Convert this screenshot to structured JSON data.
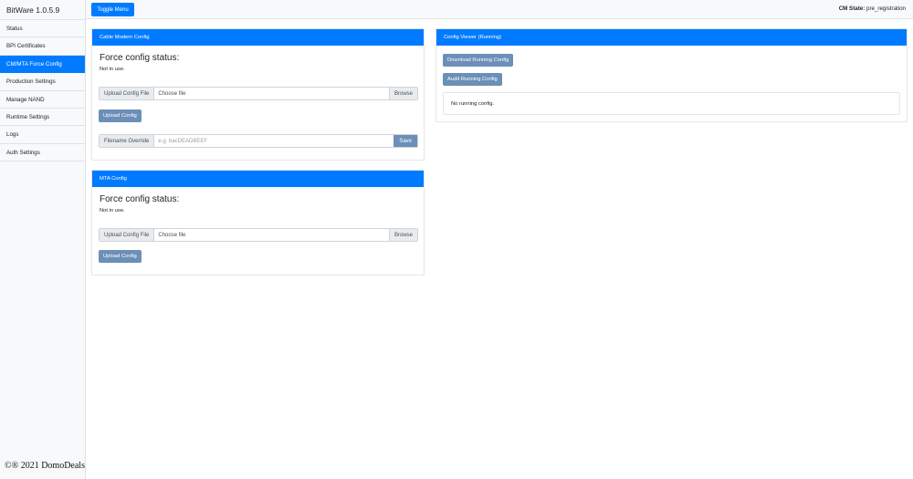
{
  "sidebar": {
    "brand": "BitWare 1.0.5.9",
    "items": [
      {
        "label": "Status",
        "active": false
      },
      {
        "label": "BPI Certificates",
        "active": false
      },
      {
        "label": "CM/MTA Force Config",
        "active": true
      },
      {
        "label": "Production Settings",
        "active": false
      },
      {
        "label": "Manage NAND",
        "active": false
      },
      {
        "label": "Runtime Settings",
        "active": false
      },
      {
        "label": "Logs",
        "active": false
      },
      {
        "label": "Auth Settings",
        "active": false
      }
    ]
  },
  "topbar": {
    "toggle_label": "Toggle Menu",
    "state_label": "CM State:",
    "state_value": "pre_registration"
  },
  "cm_card": {
    "title": "Cable Modem Config",
    "status_heading": "Force config status:",
    "status_text": "Not in use.",
    "upload_addon": "Upload Config File",
    "file_placeholder": "Choose file",
    "browse_label": "Browse",
    "upload_button": "Upload Config",
    "override_addon": "Filename Override",
    "override_placeholder": "e.g. bacDEADBEEF",
    "save_label": "Save"
  },
  "mta_card": {
    "title": "MTA Config",
    "status_heading": "Force config status:",
    "status_text": "Not in use.",
    "upload_addon": "Upload Config File",
    "file_placeholder": "Choose file",
    "browse_label": "Browse",
    "upload_button": "Upload Config"
  },
  "viewer_card": {
    "title": "Config Viewer (Running)",
    "download_button": "Download Running Config",
    "audit_button": "Audit Running Config",
    "running_text": "No running config."
  },
  "watermark": "©® 2021 DomoDeals",
  "colors": {
    "accent": "#007bff",
    "secondary_button": "#6c8fb8",
    "sidebar_bg": "#f8f9fa"
  }
}
